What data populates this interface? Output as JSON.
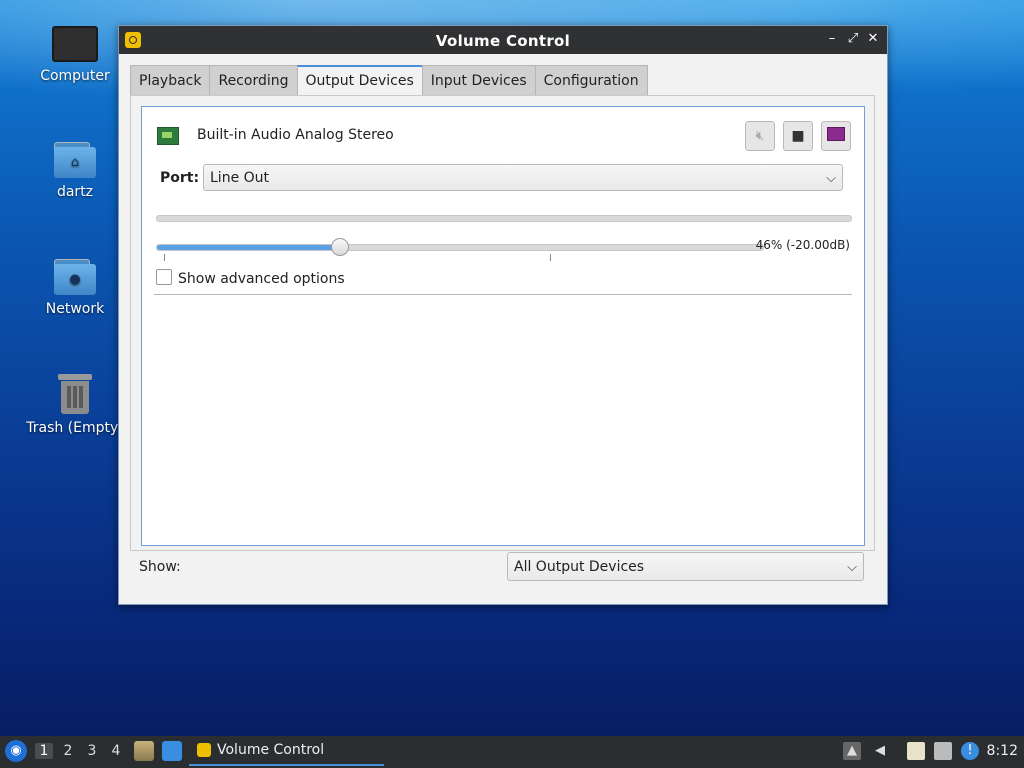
{
  "desktop": {
    "icons": [
      {
        "label": "Computer",
        "icon": "computer-icon"
      },
      {
        "label": "dartz",
        "icon": "home-folder-icon"
      },
      {
        "label": "Network",
        "icon": "network-folder-icon"
      },
      {
        "label": "Trash (Empty)",
        "icon": "trash-icon"
      }
    ]
  },
  "window": {
    "title": "Volume Control",
    "controls": {
      "minimize": "–",
      "maximize": "⤢",
      "close": "✕"
    },
    "tabs": [
      {
        "label": "Playback"
      },
      {
        "label": "Recording"
      },
      {
        "label": "Output Devices",
        "active": true
      },
      {
        "label": "Input Devices"
      },
      {
        "label": "Configuration"
      }
    ],
    "device": {
      "name": "Built-in Audio Analog Stereo",
      "port_label": "Port:",
      "port_value": "Line Out",
      "volume_percent": 46,
      "volume_text": "46% (-20.00dB)",
      "advanced_label": "Show advanced options",
      "advanced_checked": false
    },
    "footer": {
      "show_label": "Show:",
      "show_value": "All Output Devices"
    }
  },
  "taskbar": {
    "workspaces": [
      "1",
      "2",
      "3",
      "4"
    ],
    "active_workspace": "1",
    "task_label": "Volume Control",
    "clock": "8:12"
  },
  "colors": {
    "accent": "#4a90d9",
    "titlebar": "#2f3133",
    "taskbar": "#2b2e31"
  }
}
